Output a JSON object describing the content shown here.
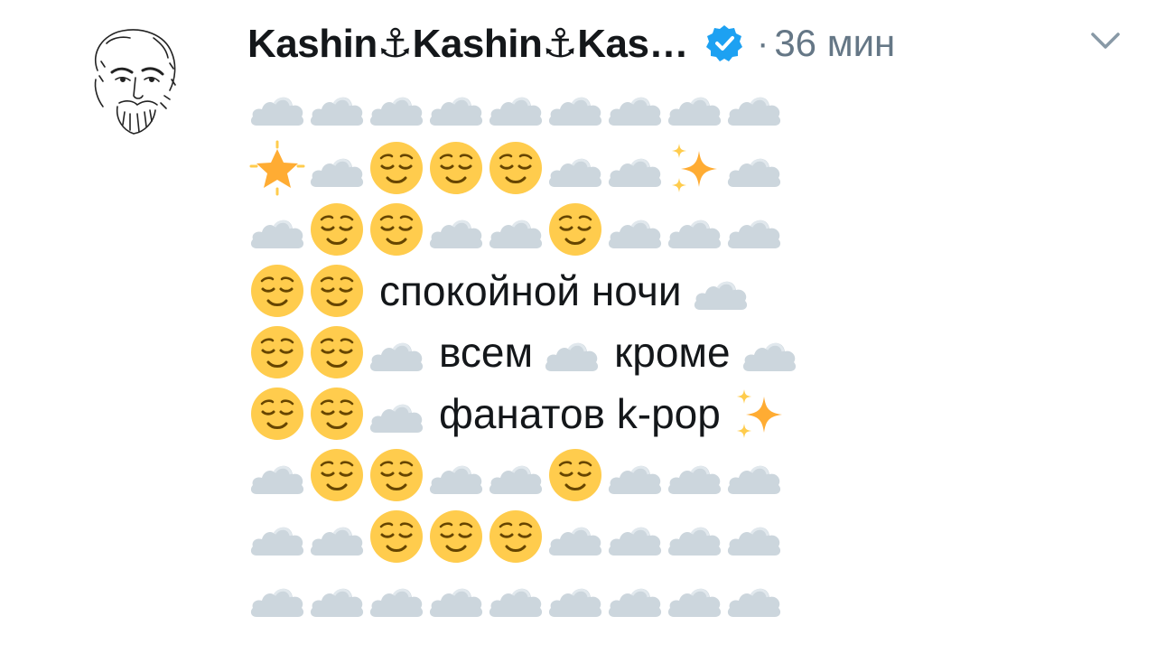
{
  "tweet": {
    "author_name": "Kashin⚓Kashin⚓Kas…",
    "separator": "·",
    "time_ago": "36 мин",
    "icons": {
      "verified": "verified-badge-icon",
      "more": "chevron-down-icon",
      "avatar": "sketch-portrait"
    },
    "colors": {
      "name": "#14171a",
      "meta": "#657786",
      "verified": "#1da1f2",
      "cloud": "#ccd6dd",
      "face": "#ffcc4d"
    },
    "text": {
      "goodnight": "спокойной ночи",
      "everyone": "всем",
      "except": "кроме",
      "fans": "фанатов k-pop"
    },
    "emoji_rows": [
      [
        "cloud",
        "cloud",
        "cloud",
        "cloud",
        "cloud",
        "cloud",
        "cloud",
        "cloud",
        "cloud"
      ],
      [
        "star",
        "cloud",
        "relieved",
        "relieved",
        "relieved",
        "cloud",
        "cloud",
        "sparkles",
        "cloud"
      ],
      [
        "cloud",
        "relieved",
        "relieved",
        "cloud",
        "cloud",
        "relieved",
        "cloud",
        "cloud",
        "cloud"
      ],
      [
        "relieved",
        "relieved",
        "text:goodnight",
        "cloud"
      ],
      [
        "relieved",
        "relieved",
        "cloud",
        "text:everyone",
        "cloud",
        "text:except",
        "cloud"
      ],
      [
        "relieved",
        "relieved",
        "cloud",
        "text:fans",
        "sparkles"
      ],
      [
        "cloud",
        "relieved",
        "relieved",
        "cloud",
        "cloud",
        "relieved",
        "cloud",
        "cloud",
        "cloud"
      ],
      [
        "cloud",
        "cloud",
        "relieved",
        "relieved",
        "relieved",
        "cloud",
        "cloud",
        "cloud",
        "cloud"
      ],
      [
        "cloud",
        "cloud",
        "cloud",
        "cloud",
        "cloud",
        "cloud",
        "cloud",
        "cloud",
        "cloud"
      ]
    ]
  }
}
